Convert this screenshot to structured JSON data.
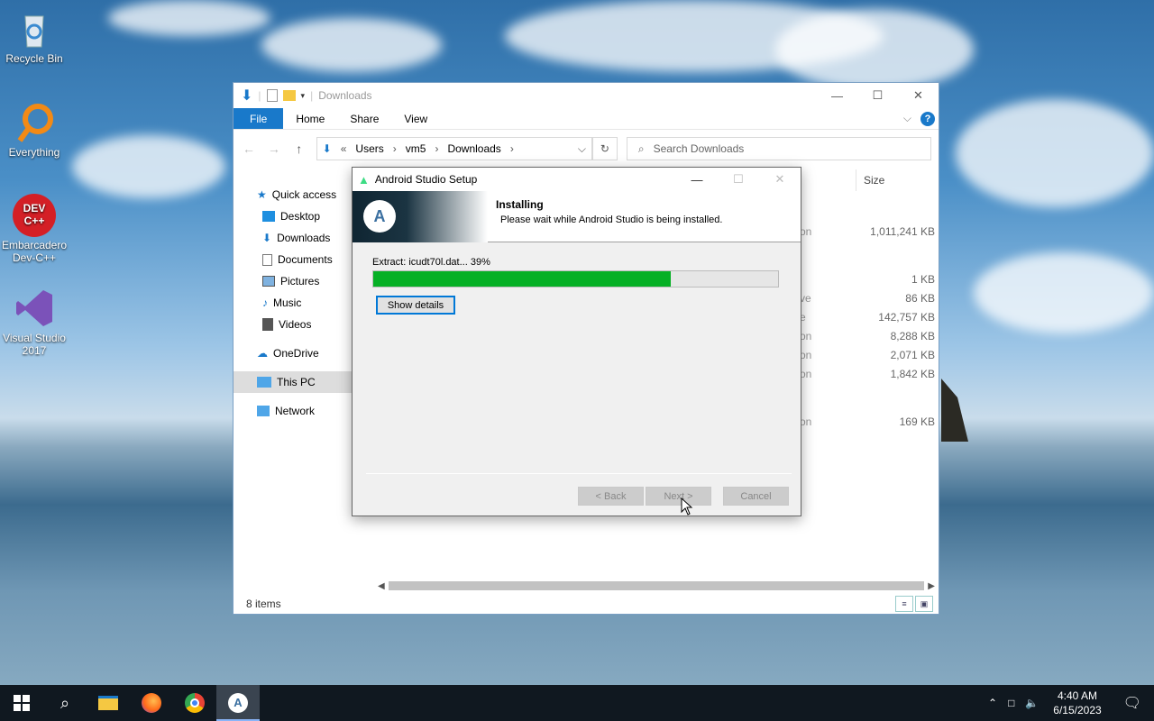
{
  "desktop": {
    "icons": [
      {
        "label": "Recycle Bin",
        "icon": "recycle-bin-icon"
      },
      {
        "label": "Everything",
        "icon": "everything-icon"
      },
      {
        "label": "Embarcadero Dev-C++",
        "icon": "devcpp-icon",
        "badge": "DEV C++"
      },
      {
        "label": "Visual Studio 2017",
        "icon": "visual-studio-icon"
      }
    ]
  },
  "explorer": {
    "title": "Downloads",
    "ribbon": {
      "file": "File",
      "home": "Home",
      "share": "Share",
      "view": "View"
    },
    "address": {
      "parts": [
        "Users",
        "vm5",
        "Downloads"
      ]
    },
    "search_placeholder": "Search Downloads",
    "nav": [
      {
        "label": "Quick access"
      },
      {
        "label": "Desktop"
      },
      {
        "label": "Downloads"
      },
      {
        "label": "Documents"
      },
      {
        "label": "Pictures"
      },
      {
        "label": "Music"
      },
      {
        "label": "Videos"
      },
      {
        "label": "OneDrive"
      },
      {
        "label": "This PC"
      },
      {
        "label": "Network"
      }
    ],
    "size_header": "Size",
    "rows": [
      {
        "type_fragment": "on",
        "size": "1,011,241 KB"
      },
      {
        "type_fragment": "",
        "size": "1 KB"
      },
      {
        "type_fragment": "ve",
        "size": "86 KB"
      },
      {
        "type_fragment": "e",
        "size": "142,757 KB"
      },
      {
        "type_fragment": "on",
        "size": "8,288 KB"
      },
      {
        "type_fragment": "on",
        "size": "2,071 KB"
      },
      {
        "type_fragment": "on",
        "size": "1,842 KB"
      },
      {
        "type_fragment": "on",
        "size": "169 KB"
      }
    ],
    "status": "8 items"
  },
  "setup": {
    "title": "Android Studio Setup",
    "header_title": "Installing",
    "header_sub": "Please wait while Android Studio is being installed.",
    "extract_text": "Extract: icudt70l.dat... 39%",
    "progress": 0.735,
    "show_details": "Show details",
    "back": "< Back",
    "next": "Next >",
    "cancel": "Cancel"
  },
  "taskbar": {
    "time": "4:40 AM",
    "date": "6/15/2023"
  },
  "colors": {
    "accent": "#1979ca",
    "progress": "#06b025",
    "taskbar": "#101820"
  }
}
